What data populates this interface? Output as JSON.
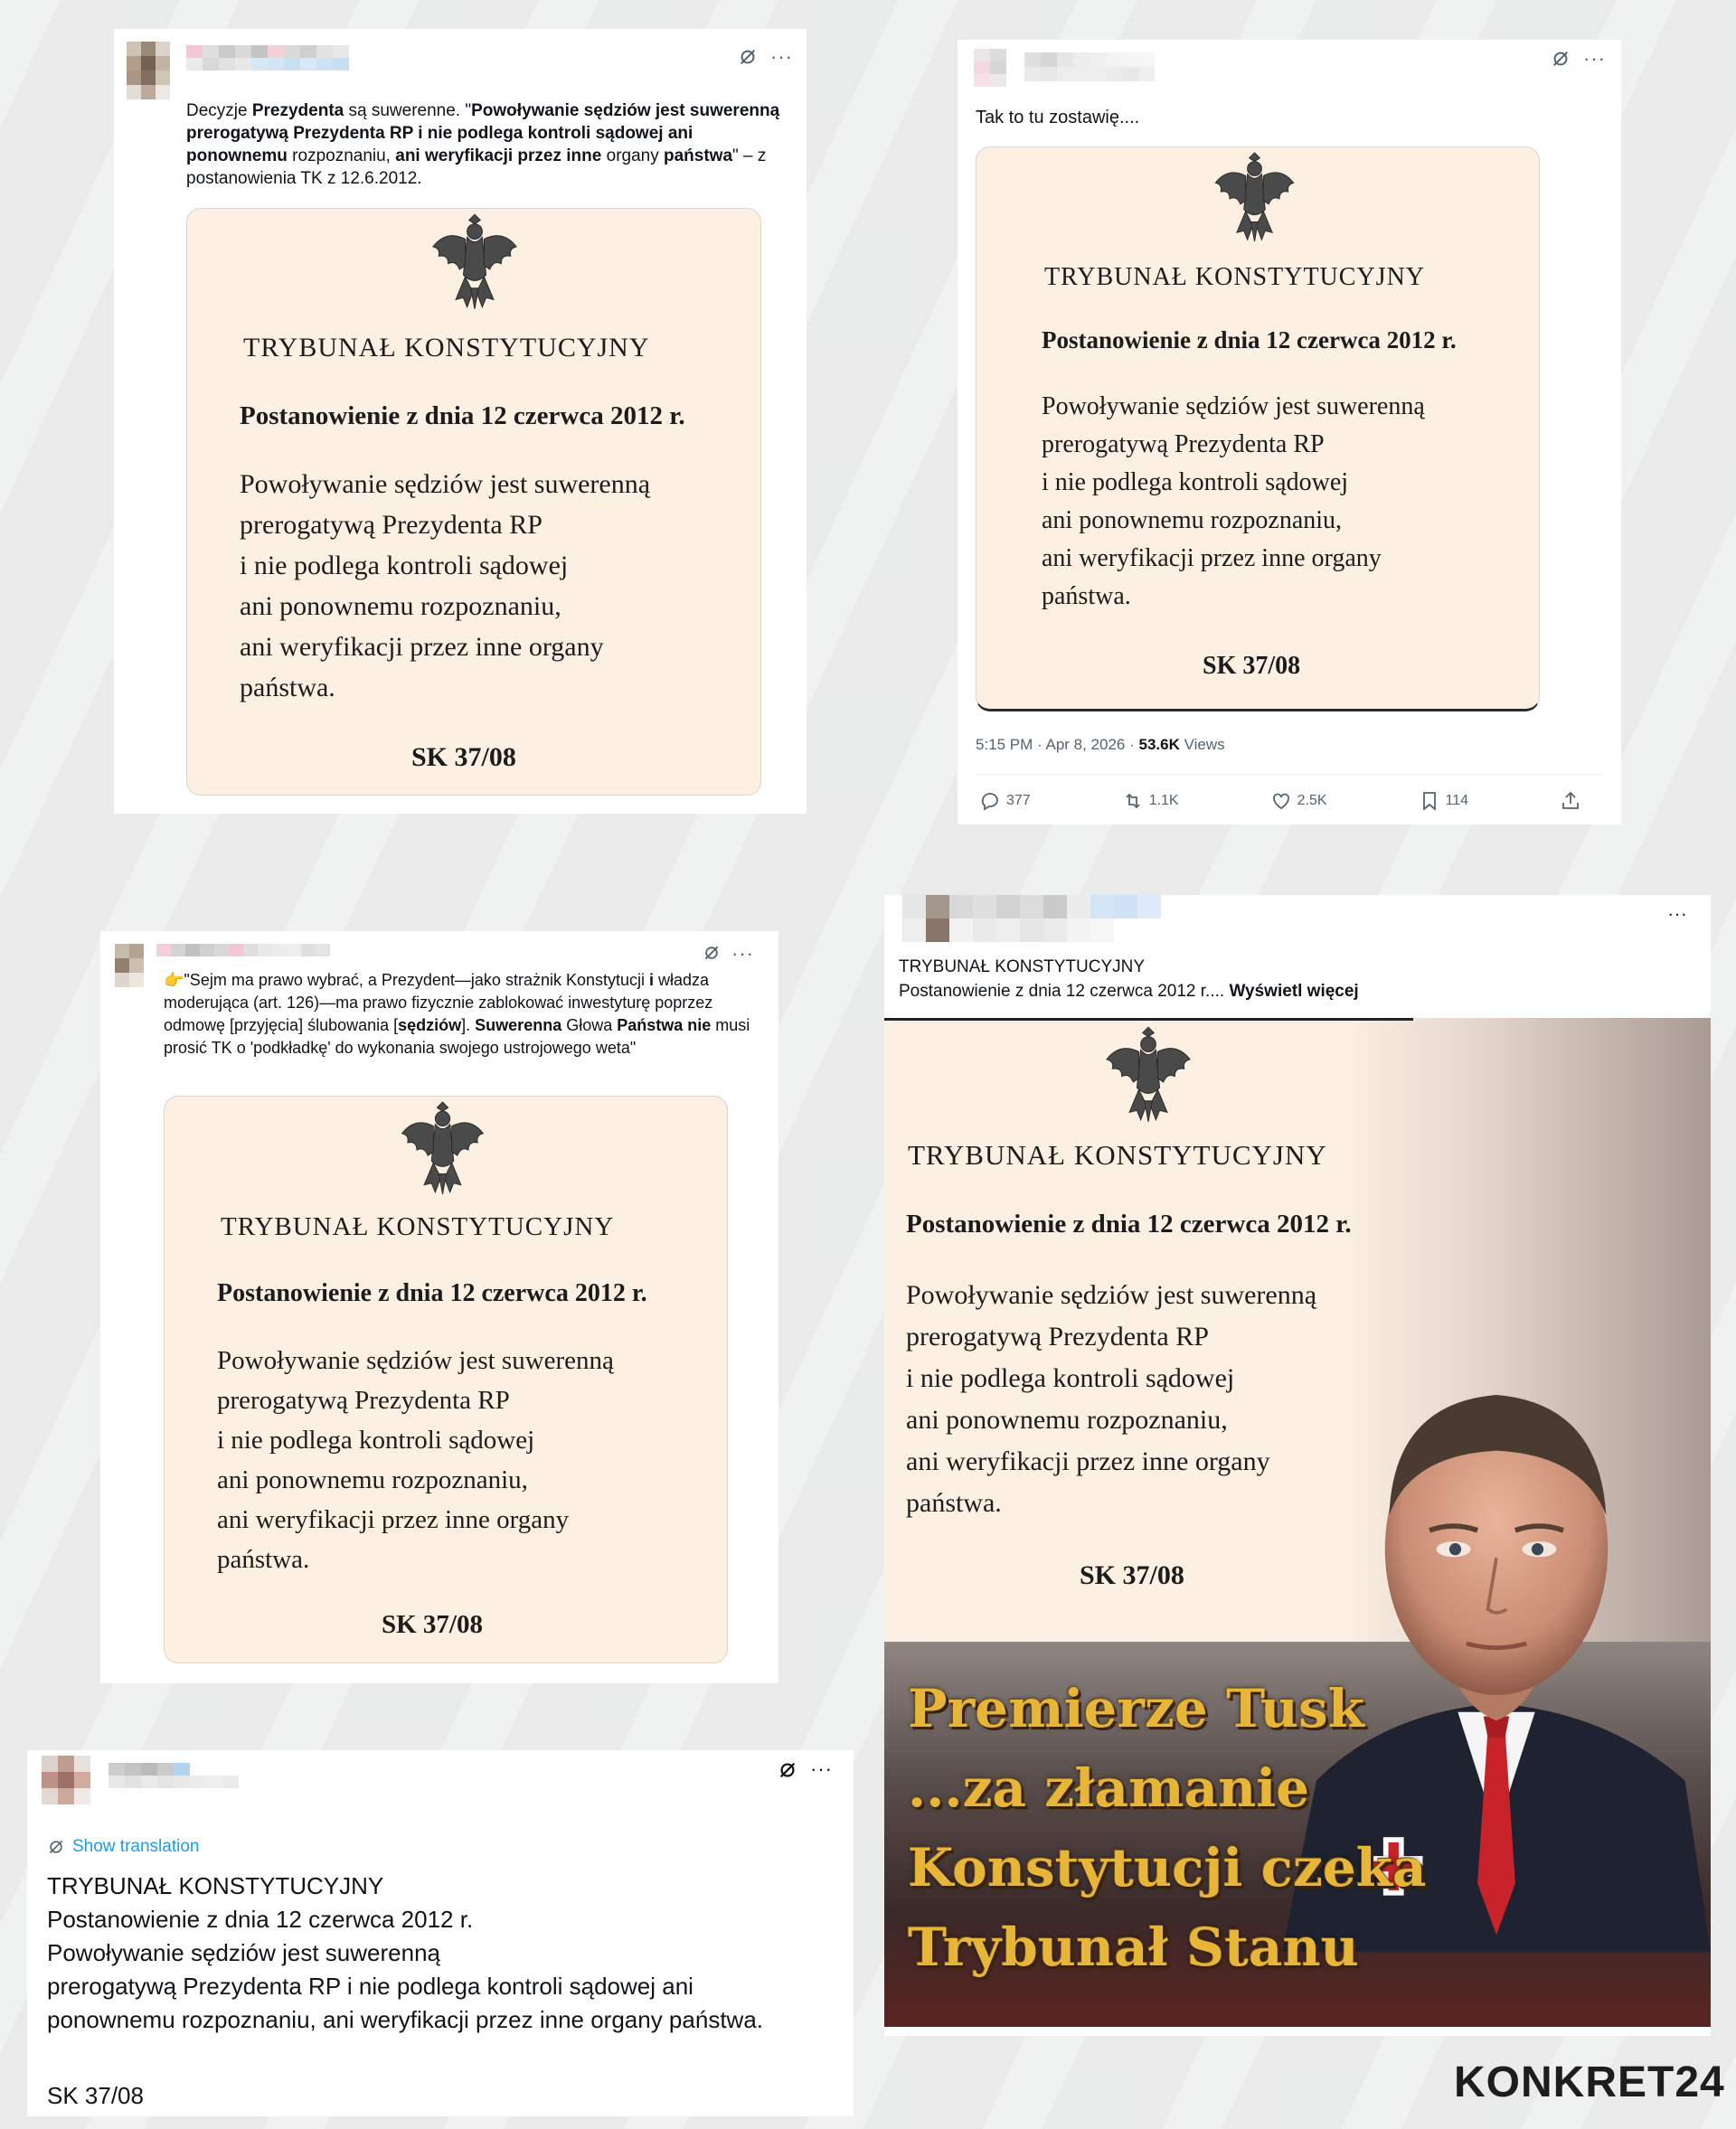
{
  "tweet1": {
    "text_parts": [
      {
        "t": "Decyzje ",
        "b": false
      },
      {
        "t": "Prezydenta",
        "b": true
      },
      {
        "t": " są suwerenne. \"",
        "b": false
      },
      {
        "t": "Powoływanie sędziów jest suwerenną prerogatywą Prezydenta RP i nie podlega kontroli sądowej ani ponownemu",
        "b": true
      },
      {
        "t": " rozpoznaniu, ",
        "b": false
      },
      {
        "t": "ani weryfikacji przez inne",
        "b": true
      },
      {
        "t": " organy ",
        "b": false
      },
      {
        "t": "państwa",
        "b": true
      },
      {
        "t": "\" – z postanowienia TK z 12.6.2012.",
        "b": false
      }
    ]
  },
  "tweet2": {
    "text": "Tak to tu zostawię....",
    "timestamp": "5:15 PM · Apr 8, 2026 · ",
    "views_count": "53.6K",
    "views_label": " Views",
    "actions": {
      "replies": "377",
      "reposts": "1.1K",
      "likes": "2.5K",
      "bookmarks": "114"
    }
  },
  "tweet3": {
    "emoji": "👉",
    "text_parts": [
      {
        "t": "\"Sejm ma prawo wybrać, a Prezydent—jako strażnik Konstytucji ",
        "b": false
      },
      {
        "t": "i",
        "b": true
      },
      {
        "t": " władza moderująca (art. 126)—ma prawo fizycznie zablokować inwestyturę poprzez odmowę [przyjęcia] ślubowania [",
        "b": false
      },
      {
        "t": "sędziów",
        "b": true
      },
      {
        "t": "]. ",
        "b": false
      },
      {
        "t": "Suwerenna",
        "b": true
      },
      {
        "t": " Głowa ",
        "b": false
      },
      {
        "t": "Państwa nie",
        "b": true
      },
      {
        "t": " musi prosić TK o 'podkładkę' do wykonania swojego ustrojowego weta\"",
        "b": false
      }
    ]
  },
  "tweet4": {
    "show_translation": "Show translation",
    "lines": [
      "TRYBUNAŁ KONSTYTUCYJNY",
      "Postanowienie z dnia 12 czerwca 2012 r.",
      "Powoływanie sędziów jest suwerenną",
      "prerogatywą Prezydenta RP i nie podlega kontroli sądowej ani",
      "ponownemu rozpoznaniu, ani weryfikacji przez inne organy państwa.",
      "",
      "SK 37/08"
    ]
  },
  "post5": {
    "line1": "TRYBUNAŁ KONSTYTUCYJNY",
    "line2": "Postanowienie z dnia 12 czerwca 2012 r.... ",
    "see_more": "Wyświetl więcej",
    "poster_lines": [
      "Premierze Tusk",
      "...za złamanie",
      "Konstytucji czeka",
      "Trybunał Stanu"
    ]
  },
  "document": {
    "title": "TRYBUNAŁ KONSTYTUCYJNY",
    "date": "Postanowienie z dnia 12 czerwca 2012 r.",
    "body": [
      "Powoływanie sędziów jest suwerenną",
      "prerogatywą Prezydenta RP",
      "i nie podlega kontroli sądowej",
      "ani ponownemu rozpoznaniu,",
      "ani weryfikacji przez inne organy",
      "państwa."
    ],
    "signature": "SK 37/08"
  },
  "logo": {
    "text": "KONKRET24"
  },
  "colors": {
    "background": "#eceded",
    "document_bg": "#fbf0e2",
    "link_blue": "#1d9bf0",
    "poster_gold": "#e7b537"
  },
  "icons": [
    "grok-icon",
    "more-icon",
    "reply-icon",
    "repost-icon",
    "like-icon",
    "bookmark-icon",
    "share-icon",
    "translate-icon",
    "eagle-emblem-icon"
  ]
}
